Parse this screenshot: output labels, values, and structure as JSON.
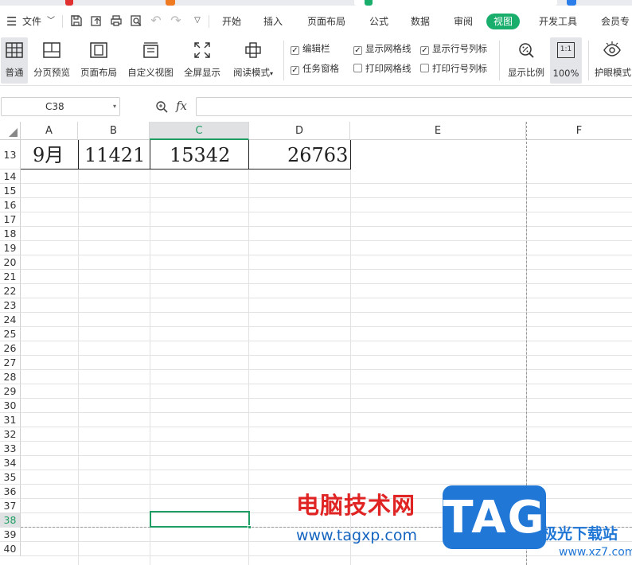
{
  "menubar": {
    "file_label": "文件",
    "tabs": [
      {
        "label": "开始"
      },
      {
        "label": "插入"
      },
      {
        "label": "页面布局"
      },
      {
        "label": "公式"
      },
      {
        "label": "数据"
      },
      {
        "label": "审阅"
      },
      {
        "label": "视图"
      },
      {
        "label": "开发工具"
      },
      {
        "label": "会员专"
      }
    ],
    "active_tab": "视图",
    "accent_color": "#1aae6d"
  },
  "ribbon": {
    "buttons": [
      {
        "label": "普通",
        "icon": "grid-icon",
        "selected": true
      },
      {
        "label": "分页预览",
        "icon": "page-break-icon"
      },
      {
        "label": "页面布局",
        "icon": "page-layout-icon"
      },
      {
        "label": "自定义视图",
        "icon": "custom-view-icon"
      },
      {
        "label": "全屏显示",
        "icon": "fullscreen-icon"
      },
      {
        "label": "阅读模式",
        "icon": "crosshair-icon"
      }
    ],
    "checkboxes": [
      {
        "label": "编辑栏",
        "checked": true
      },
      {
        "label": "任务窗格",
        "checked": true
      },
      {
        "label": "显示网格线",
        "checked": true
      },
      {
        "label": "打印网格线",
        "checked": false
      },
      {
        "label": "显示行号列标",
        "checked": true
      },
      {
        "label": "打印行号列标",
        "checked": false
      }
    ],
    "zoom_button": {
      "label": "显示比例",
      "icon": "zoom-percent-icon"
    },
    "zoom_100": {
      "label": "100%",
      "icon_text": "1:1"
    },
    "eye_button": {
      "label": "护眼模式",
      "icon": "eye-icon"
    }
  },
  "formula_bar": {
    "name_box": "C38",
    "fx_label": "fx",
    "formula_value": ""
  },
  "sheet": {
    "columns": [
      "A",
      "B",
      "C",
      "D",
      "E",
      "F"
    ],
    "selected_column": "C",
    "first_row": 13,
    "rows": [
      "13",
      "14",
      "15",
      "16",
      "17",
      "18",
      "19",
      "20",
      "21",
      "22",
      "23",
      "24",
      "25",
      "26",
      "27",
      "28",
      "29",
      "30",
      "31",
      "32",
      "33",
      "34",
      "35",
      "36",
      "37",
      "38",
      "39",
      "40"
    ],
    "selected_row": "38",
    "data_row": {
      "A": "9月",
      "B": "11421",
      "C": "15342",
      "D": "26763"
    },
    "selected_cell": "C38",
    "selection_color": "#1e9e63"
  },
  "watermark": {
    "site_cn": "电脑技术网",
    "site_url": "www.tagxp.com",
    "logo_text": "TAG",
    "site2_cn": "极光下载站",
    "site2_url": "www.xz7.com"
  }
}
